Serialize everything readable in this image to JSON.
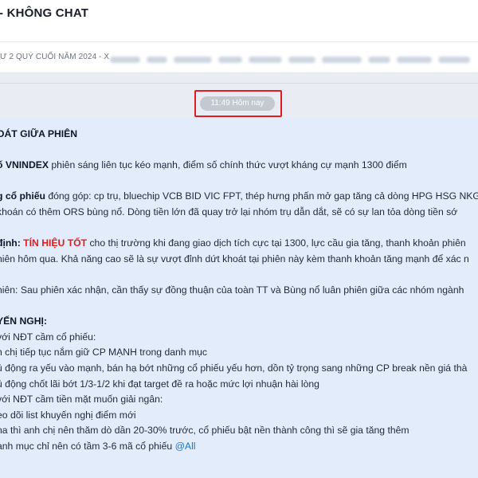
{
  "header": {
    "title": "- KHÔNG CHAT"
  },
  "subheader": {
    "breadcrumb": "Ư 2 QUÝ CUỐI NĂM 2024 - X"
  },
  "chat": {
    "time_separator": "11:49 Hôm nay",
    "message": {
      "heading": "OÁT GIỮA PHIÊN",
      "vnindex_label": "ố VNINDEX",
      "vnindex_text": " phiên sáng liên tục kéo mạnh, điểm số chính thức vượt kháng cự mạnh 1300 điểm",
      "stocks_label": "g cổ phiếu",
      "stocks_text_1": " đóng góp: cp trụ, bluechip VCB BID VIC FPT, thép hưng phấn mở gap tăng cả dòng HPG HSG NKG",
      "stocks_text_2": " khoán có thêm ORS bùng nổ. Dòng tiền lớn đã quay trở lại nhóm trụ dẫn dắt, sẽ có sự lan tỏa dòng tiền sớ",
      "assess_label": "định:",
      "assess_signal": "TÍN HIỆU TỐT",
      "assess_text_1": " cho thị trường khi đang giao dịch tích cực tại 1300, lực cầu gia tăng, thanh khoản phiên",
      "assess_text_2": "hiên hôm qua. Khả năng cao sẽ là sự vượt đỉnh dứt khoát tại phiên này kèm thanh khoản tăng mạnh để xác n",
      "next_session": "hiên: Sau phiên xác nhận, cần thấy sự đồng thuận của toàn TT và Bùng nổ luân phiên giữa các nhóm ngành",
      "reco_heading": "YẾN NGHỊ:",
      "reco_1": "với NĐT cầm cổ phiếu:",
      "reco_2": "h chị tiếp tục nắm giữ CP MẠNH trong danh mục",
      "reco_3": "ủ động ra yếu vào mạnh, bán hạ bớt những cổ phiếu yếu hơn, dồn tỷ trọng sang những CP break nền giá thà",
      "reco_4": "ủ động chốt lãi bớt 1/3-1/2 khi đạt target đề ra hoặc mức lợi nhuận hài lòng",
      "reco_5": "với NĐT cầm tiền mặt muốn giải ngân:",
      "reco_6": "eo dõi list khuyến nghị điểm mới",
      "reco_7": "na thì anh chị nên thăm dò dần 20-30% trước, cổ phiếu bật nền thành công thì sẽ gia tăng thêm",
      "reco_8": "anh mục chỉ nên có tầm 3-6 mã cổ phiếu ",
      "mention": "@All"
    }
  },
  "colors": {
    "highlight_border": "#e11d22",
    "signal_red": "#e11d22",
    "mention_blue": "#1677d2",
    "bubble_bg": "#e2ecfb",
    "chat_bg": "#e9ecf3"
  }
}
